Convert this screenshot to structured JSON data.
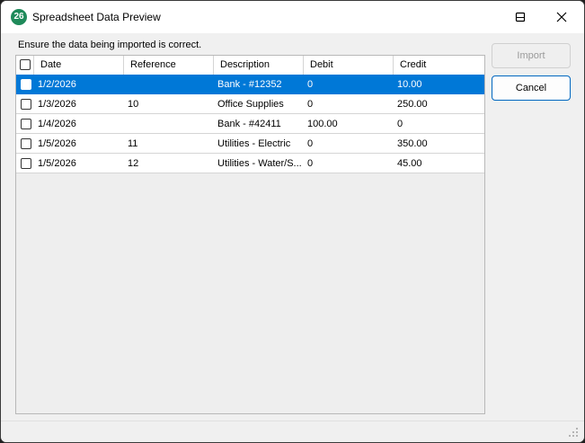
{
  "window": {
    "title": "Spreadsheet Data Preview",
    "icon_text": "26",
    "icon_color": "#1f8a5a",
    "controls": [
      "minimize-icon",
      "maximize-icon",
      "close-icon"
    ]
  },
  "instruction": "Ensure the data being imported is correct.",
  "grid": {
    "columns": [
      "Date",
      "Reference",
      "Description",
      "Debit",
      "Credit"
    ],
    "rows": [
      {
        "date": "1/2/2026",
        "reference": "",
        "description": "Bank - #12352",
        "debit": "0",
        "credit": "10.00",
        "selected": true,
        "checked": false
      },
      {
        "date": "1/3/2026",
        "reference": "10",
        "description": "Office Supplies",
        "debit": "0",
        "credit": "250.00",
        "selected": false,
        "checked": false
      },
      {
        "date": "1/4/2026",
        "reference": "",
        "description": "Bank - #42411",
        "debit": "100.00",
        "credit": "0",
        "selected": false,
        "checked": false
      },
      {
        "date": "1/5/2026",
        "reference": "11",
        "description": "Utilities - Electric",
        "debit": "0",
        "credit": "350.00",
        "selected": false,
        "checked": false
      },
      {
        "date": "1/5/2026",
        "reference": "12",
        "description": "Utilities - Water/S...",
        "debit": "0",
        "credit": "45.00",
        "selected": false,
        "checked": false
      }
    ],
    "selection_color": "#0078d7"
  },
  "buttons": {
    "import_label": "Import",
    "cancel_label": "Cancel"
  }
}
